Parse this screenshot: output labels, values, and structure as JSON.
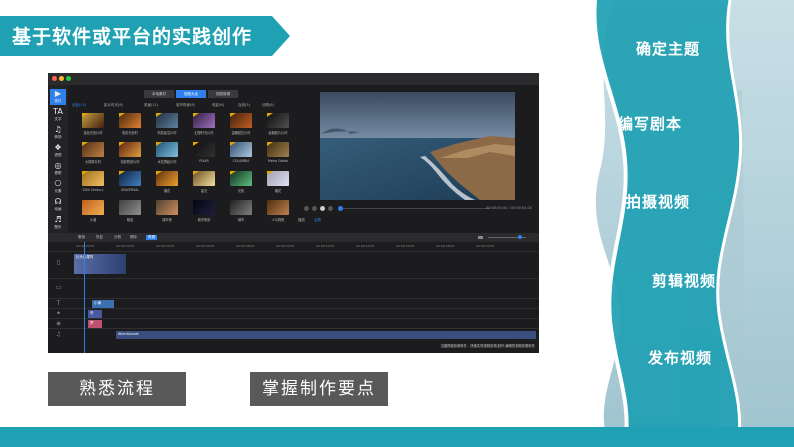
{
  "title": "基于软件或平台的实践创作",
  "steps": [
    "确定主题",
    "编写剧本",
    "拍摄视频",
    "剪辑视频",
    "发布视频"
  ],
  "buttons": {
    "left": "熟悉流程",
    "right": "掌握制作要点"
  },
  "colors": {
    "accent": "#1fa0b3",
    "button_bg": "#595959",
    "editor_bg": "#1c1c1e",
    "editor_blue": "#2f80ed"
  },
  "editor": {
    "tabs": [
      "本地素材",
      "视频大全",
      "视频剪辑"
    ],
    "active_tab_index": 1,
    "sidebar": [
      {
        "icon": "▶",
        "label": "素材"
      },
      {
        "icon": "TA",
        "label": "文字"
      },
      {
        "icon": "♫",
        "label": "转场"
      },
      {
        "icon": "❖",
        "label": "滤镜"
      },
      {
        "icon": "◎",
        "label": "叠附"
      },
      {
        "icon": "⎔",
        "label": "元素"
      },
      {
        "icon": "☊",
        "label": "动画"
      },
      {
        "icon": "♬",
        "label": "配乐"
      }
    ],
    "categories": [
      "全部(15)",
      "影片时光(8)",
      "风景(11)",
      "城市夜景(8)",
      "电影(6)",
      "自然(5)",
      "动物(6)"
    ],
    "thumbnails": [
      [
        "金色光影片时",
        "电影光影时",
        "科技星空片时",
        "幻想时光片时",
        "温暖回忆片时",
        "经典胶片片时"
      ],
      [
        "大磁带片时",
        "电影院影片时",
        "水花溅起片时",
        "PIXAR",
        "COLUMBIA",
        "Metro Goldw"
      ],
      [
        "20th Century",
        "UNIVERSAL",
        "烟花",
        "星光",
        "光影",
        "烟花"
      ],
      [
        "沙滩",
        "晚霞",
        "城市夜",
        "城市夜景",
        "城市",
        "人与狗狗"
      ]
    ],
    "preview_labels": [
      "播放",
      "全屏"
    ],
    "time_readout": "00:00:00.00 / 00:00:04.00",
    "timeline_tools": [
      "撤销",
      "恢复",
      "分割",
      "删除",
      "剪辑"
    ],
    "ruler": [
      "00:00:00.00",
      "00:00:02.00",
      "00:00:04.00",
      "00:00:06.00",
      "00:00:08.00",
      "00:00:10.00",
      "00:00:12.00",
      "00:00:14.00",
      "00:00:16.00",
      "00:00:18.00",
      "00:00:20.00"
    ],
    "clips": {
      "video": "片头片尾时",
      "text1": "小满",
      "text2": "冬",
      "text3": "梦",
      "music": "AlienSunset"
    },
    "status": "迅捷视频剪辑软件 - 快速实现视频剪辑,制作,编辑的视频剪辑软件"
  }
}
